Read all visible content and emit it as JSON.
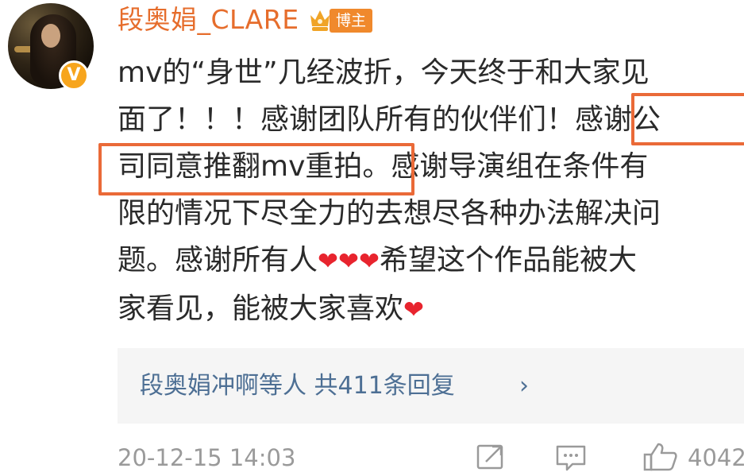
{
  "post": {
    "username": "段奥娟_CLARE",
    "badge": "博主",
    "lines": [
      "mv的“身世”几经波折，今天终于和大家见",
      "面了！！！感谢团队所有的伙伴们！感谢公",
      "司同意推翻mv重拍。感谢导演组在条件有",
      "限的情况下尽全力的去想尽各种办法解决问"
    ],
    "line5_before": "题。感谢所有人",
    "line5_hearts": "❤❤❤",
    "line5_after": "希望这个作品能被大",
    "line6_before": "家看见，能被大家喜欢",
    "line6_heart": "❤",
    "replies": {
      "text": "段奥娟冲啊等人 共411条回复",
      "arrow": "›"
    },
    "timestamp": "20-12-15 14:03",
    "like_count": "4042",
    "icons": {
      "repost": "share-icon",
      "comment": "comment-icon",
      "like": "thumbs-up-icon",
      "verified": "verified-v-icon",
      "crown": "crown-icon"
    },
    "colors": {
      "username": "#e66d2c",
      "highlight_box": "#ea6a38",
      "reply_link": "#4d6f94",
      "heart": "#e8242e",
      "meta": "#9a9a9a"
    }
  }
}
